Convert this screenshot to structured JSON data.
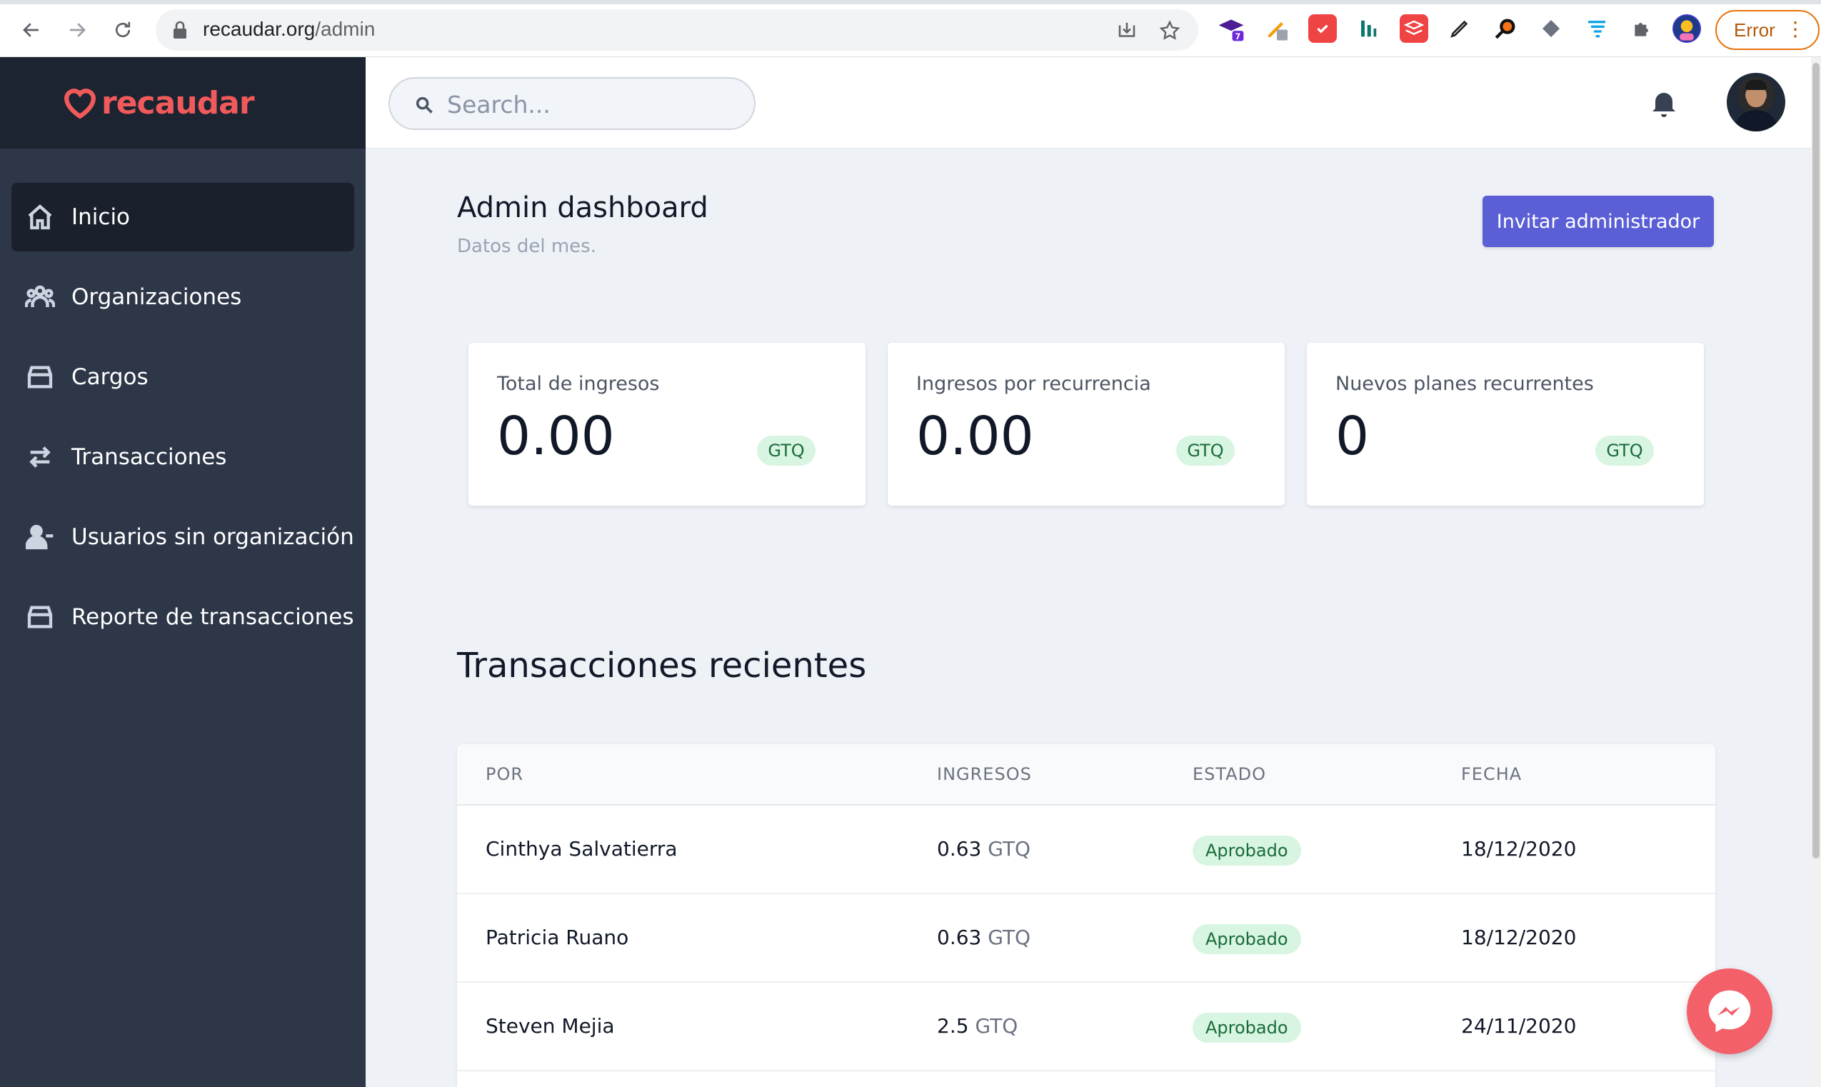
{
  "browser": {
    "url_host": "recaudar.org",
    "url_path": "/admin",
    "error_label": "Error",
    "extensions": [
      "graduation-cap-icon",
      "pencil-ruler-icon",
      "calendar-icon",
      "bar-chart-icon",
      "layers-icon",
      "pen-icon",
      "magnifier-icon",
      "diamond-icon",
      "filter-icon",
      "puzzle-icon",
      "profile-avatar"
    ],
    "ext_badge": "7"
  },
  "brand": {
    "logo_text": "recaudar",
    "logo_color": "#f05a5a"
  },
  "sidebar": {
    "items": [
      {
        "label": "Inicio",
        "icon": "home-icon",
        "active": true
      },
      {
        "label": "Organizaciones",
        "icon": "users-group-icon"
      },
      {
        "label": "Cargos",
        "icon": "archive-icon"
      },
      {
        "label": "Transacciones",
        "icon": "switch-arrows-icon"
      },
      {
        "label": "Usuarios sin organización",
        "icon": "user-minus-icon"
      },
      {
        "label": "Reporte de transacciones",
        "icon": "archive-icon"
      }
    ]
  },
  "header": {
    "search_placeholder": "Search..."
  },
  "main": {
    "title": "Admin dashboard",
    "subtitle": "Datos del mes.",
    "invite_button": "Invitar administrador",
    "accent_color": "#5b5fd6"
  },
  "stats": [
    {
      "label": "Total de ingresos",
      "value": "0.00",
      "currency": "GTQ"
    },
    {
      "label": "Ingresos por recurrencia",
      "value": "0.00",
      "currency": "GTQ"
    },
    {
      "label": "Nuevos planes recurrentes",
      "value": "0",
      "currency": "GTQ"
    }
  ],
  "transactions": {
    "title": "Transacciones recientes",
    "columns": [
      "POR",
      "INGRESOS",
      "ESTADO",
      "FECHA"
    ],
    "rows": [
      {
        "por": "Cinthya Salvatierra",
        "amount": "0.63",
        "currency": "GTQ",
        "estado": "Aprobado",
        "fecha": "18/12/2020"
      },
      {
        "por": "Patricia Ruano",
        "amount": "0.63",
        "currency": "GTQ",
        "estado": "Aprobado",
        "fecha": "18/12/2020"
      },
      {
        "por": "Steven Mejia",
        "amount": "2.5",
        "currency": "GTQ",
        "estado": "Aprobado",
        "fecha": "24/11/2020"
      }
    ]
  }
}
